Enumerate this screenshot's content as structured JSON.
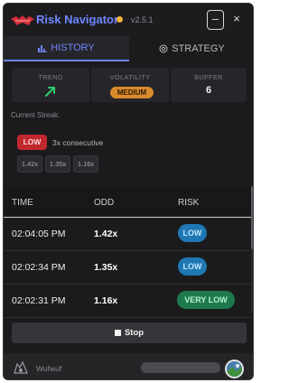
{
  "header": {
    "title": "Risk Navigator",
    "version": "v2.5.1",
    "status_color": "#f3b43a",
    "minimize_label": "–",
    "close_label": "×"
  },
  "tabs": [
    {
      "label": "HISTORY",
      "icon": "bar-chart-icon",
      "active": true
    },
    {
      "label": "STRATEGY",
      "icon": "target-icon",
      "active": false
    }
  ],
  "stats": {
    "trend": {
      "label": "TREND",
      "icon": "arrow-up-right-icon",
      "color": "#2ecc71"
    },
    "volatility": {
      "label": "VOLATILITY",
      "value": "MEDIUM",
      "color": "#d98a2a"
    },
    "buffer": {
      "label": "BUFFER",
      "value": "6"
    }
  },
  "streak": {
    "label": "Current Streak:",
    "badge": "LOW",
    "count_text": "3x consecutive",
    "chips": [
      "1.42x",
      "1.35x",
      "1.16x"
    ]
  },
  "table": {
    "columns": [
      "TIME",
      "ODD",
      "RISK"
    ],
    "rows": [
      {
        "time": "02:04:05 PM",
        "odd": "1.42x",
        "risk": "LOW"
      },
      {
        "time": "02:02:34 PM",
        "odd": "1.35x",
        "risk": "LOW"
      },
      {
        "time": "02:02:31 PM",
        "odd": "1.16x",
        "risk": "VERY LOW"
      }
    ]
  },
  "stop_button": {
    "label": "Stop"
  },
  "footer": {
    "username": "Wufwuf"
  }
}
